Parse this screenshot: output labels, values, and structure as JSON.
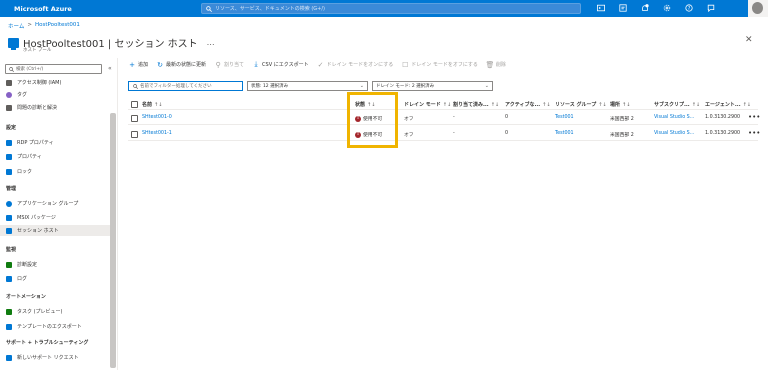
{
  "topbar": {
    "brand": "Microsoft Azure",
    "search_placeholder": "リソース、サービス、ドキュメントの検索 (G+/)",
    "icons": [
      "cloud-shell-icon",
      "directory-filter-icon",
      "notifications-icon",
      "settings-icon",
      "help-icon",
      "feedback-icon"
    ]
  },
  "breadcrumb": {
    "home": "ホーム",
    "separator": ">",
    "parent": "HostPooltest001"
  },
  "header": {
    "title": "HostPooltest001 | セッション ホスト",
    "subtitle": "ホスト プール",
    "more": "…"
  },
  "sidebar": {
    "search_placeholder": "検索 (Ctrl+/)",
    "collapse": "«",
    "items_top": [
      {
        "label": "アクセス制御 (IAM)",
        "color": "#605e5c"
      },
      {
        "label": "タグ",
        "color": "#8661c5"
      },
      {
        "label": "問題の診断と解決",
        "color": "#605e5c"
      }
    ],
    "section_settings": "設定",
    "items_settings": [
      {
        "label": "RDP プロパティ",
        "color": "#0078d4"
      },
      {
        "label": "プロパティ",
        "color": "#0078d4"
      },
      {
        "label": "ロック",
        "color": "#0078d4"
      }
    ],
    "section_manage": "管理",
    "items_manage": [
      {
        "label": "アプリケーション グループ",
        "color": "#0078d4"
      },
      {
        "label": "MSIX パッケージ",
        "color": "#0078d4"
      },
      {
        "label": "セッション ホスト",
        "color": "#0078d4"
      }
    ],
    "section_monitor": "監視",
    "items_monitor": [
      {
        "label": "診断設定",
        "color": "#107c10"
      },
      {
        "label": "ログ",
        "color": "#0078d4"
      }
    ],
    "section_automation": "オートメーション",
    "items_automation": [
      {
        "label": "タスク (プレビュー)",
        "color": "#107c10"
      },
      {
        "label": "テンプレートのエクスポート",
        "color": "#0078d4"
      }
    ],
    "section_support": "サポート + トラブルシューティング",
    "items_support": [
      {
        "label": "新しいサポート リクエスト",
        "color": "#0078d4"
      }
    ]
  },
  "toolbar": {
    "add": "追加",
    "refresh": "最新の状態に更新",
    "assign": "割り当て",
    "export": "CSV にエクスポート",
    "drain_on": "ドレイン モードをオンにする",
    "drain_off": "ドレイン モードをオフにする",
    "delete": "削除"
  },
  "filters": {
    "name_placeholder": "名前でフィルター処理してください",
    "status_filter": "状態: 12 選択済み",
    "drain_filter": "ドレイン モード: 2 選択済み"
  },
  "columns": {
    "name": "名前",
    "status": "状態",
    "drain_mode": "ドレイン モード",
    "assigned": "割り当て済み...",
    "active": "アクティブな...",
    "resource_group": "リソース グループ",
    "location": "場所",
    "subscription": "サブスクリプ...",
    "agent": "エージェント..."
  },
  "sort_glyph": "↑↓",
  "rows": [
    {
      "name": "SHtest001-0",
      "status": "使用不可",
      "drain": "オフ",
      "assigned": "-",
      "active": "0",
      "resource_group": "Test001",
      "location": "米国西部 2",
      "subscription": "Visual Studio S...",
      "agent": "1.0.3130.2900",
      "more": "•••"
    },
    {
      "name": "SHtest001-1",
      "status": "使用不可",
      "drain": "オフ",
      "assigned": "-",
      "active": "0",
      "resource_group": "Test001",
      "location": "米国西部 2",
      "subscription": "Visual Studio S...",
      "agent": "1.0.3130.2900",
      "more": "•••"
    }
  ],
  "colors": {
    "accent": "#0078d4",
    "error": "#a4262c",
    "highlight": "#f0b400"
  }
}
